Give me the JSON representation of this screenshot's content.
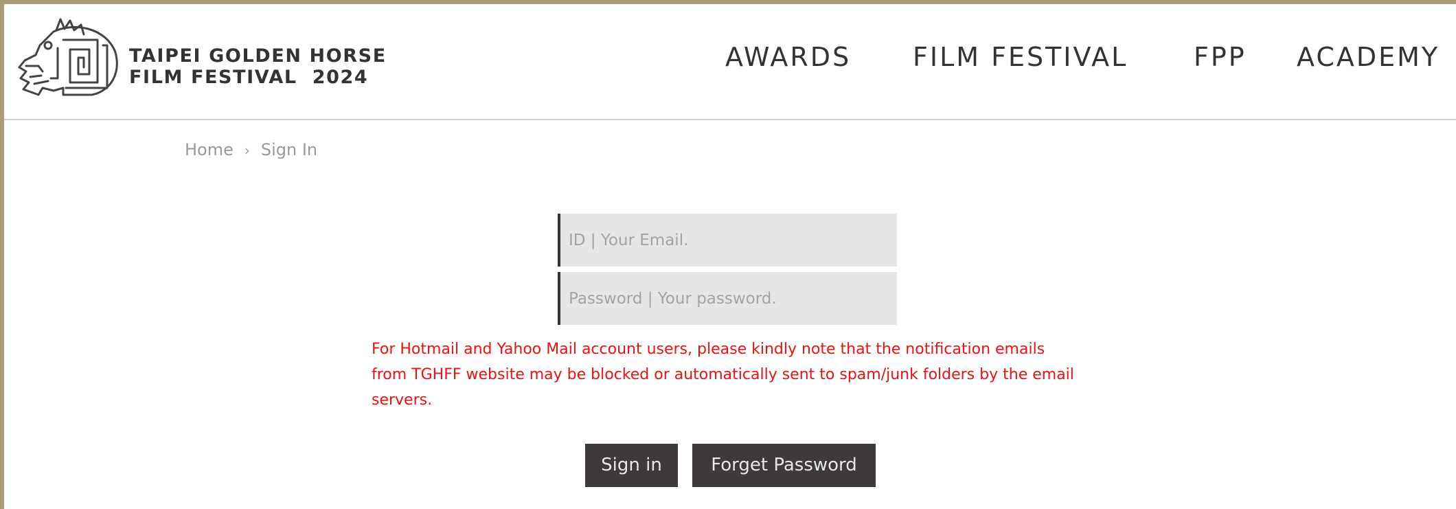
{
  "header": {
    "logo": {
      "icon": "horse-head-logo-icon",
      "line1": "TAIPEI GOLDEN HORSE",
      "line2": "FILM FESTIVAL  2024"
    },
    "nav": [
      {
        "label": "AWARDS"
      },
      {
        "label": "FILM FESTIVAL"
      },
      {
        "label": "FPP"
      },
      {
        "label": "ACADEMY"
      }
    ]
  },
  "breadcrumb": {
    "home": "Home",
    "separator": "›",
    "current": "Sign In"
  },
  "form": {
    "id_placeholder": "ID | Your Email.",
    "id_value": "",
    "password_placeholder": "Password | Your password.",
    "password_value": "",
    "notice": "For Hotmail and Yahoo Mail account users, please kindly note that the notification emails from TGHFF website may be blocked or automatically sent to spam/junk folders by the email servers.",
    "signin_label": "Sign in",
    "forget_label": "Forget Password"
  },
  "colors": {
    "frame": "#a89a7c",
    "text_dark": "#333333",
    "notice": "#ee1111",
    "button_bg": "#3d3a39",
    "field_bg": "#e6e6e6"
  }
}
